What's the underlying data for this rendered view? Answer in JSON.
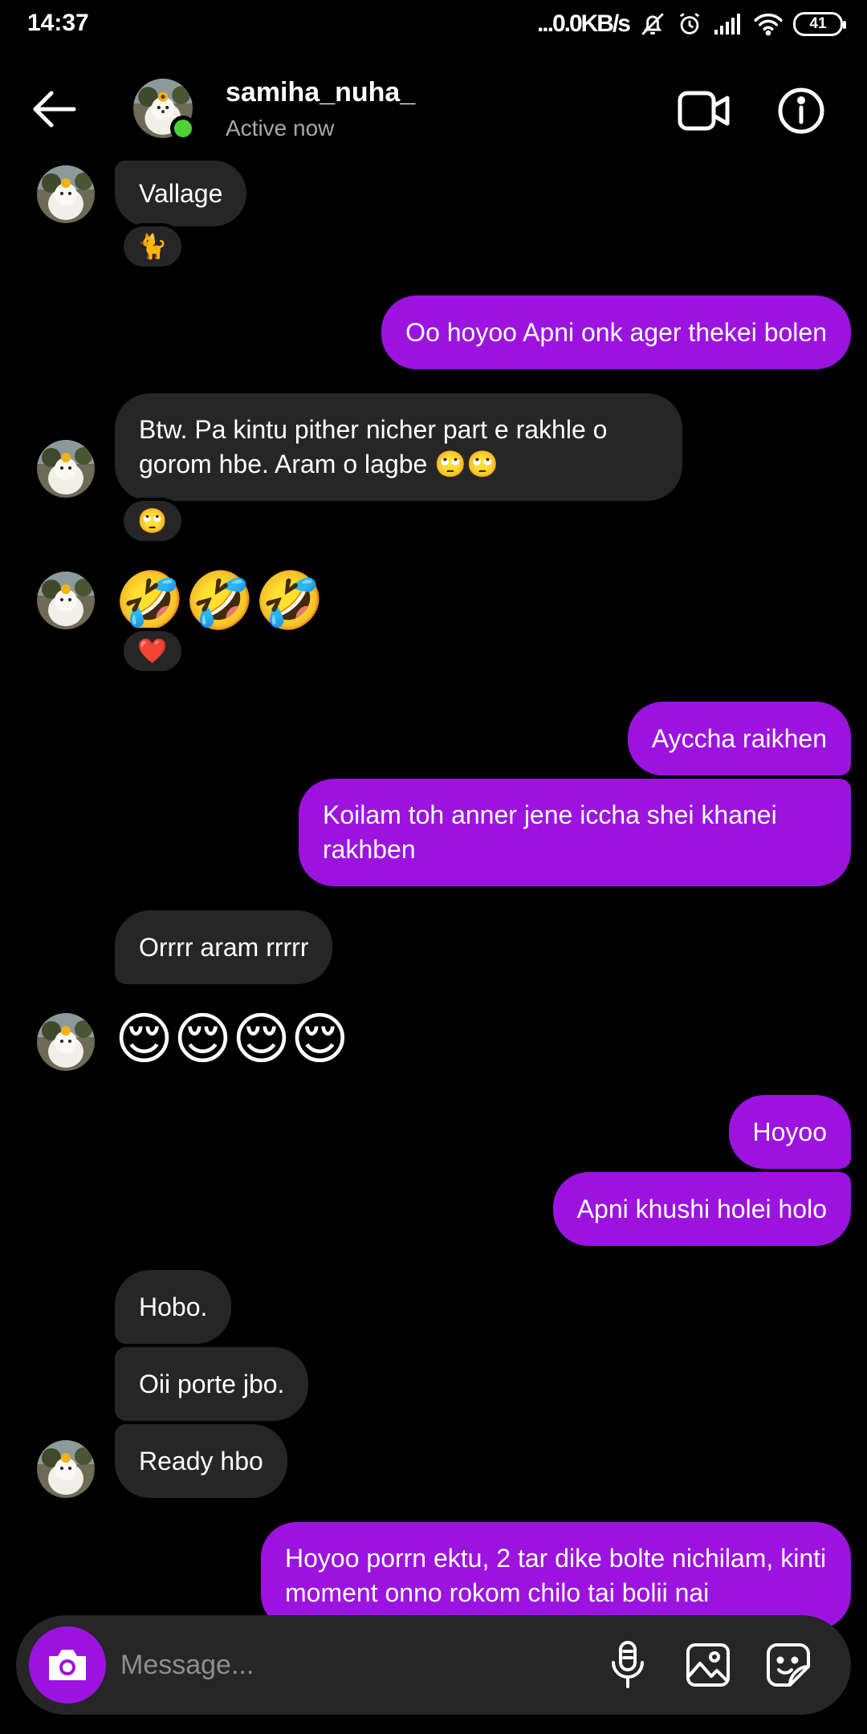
{
  "status_bar": {
    "time": "14:37",
    "network_speed": "...0.0KB/s",
    "battery": "41"
  },
  "header": {
    "username": "samiha_nuha_",
    "status": "Active now"
  },
  "messages": {
    "m1": "Vallage",
    "m1_reaction": "🐈",
    "m2": "Oo hoyoo Apni onk ager thekei bolen",
    "m3": "Btw. Pa kintu pither nicher part e rakhle o gorom hbe. Aram o lagbe 🙄🙄",
    "m3_reaction": "🙄",
    "m4": "🤣🤣🤣",
    "m4_reaction": "❤️",
    "m5": "Ayccha raikhen",
    "m6": "Koilam toh anner jene iccha shei khanei rakhben",
    "m7": "Orrrr aram rrrrr",
    "m8": "😌😌😌😌",
    "m9": "Hoyoo",
    "m10": "Apni khushi holei holo",
    "m11": "Hobo.",
    "m12": "Oii porte jbo.",
    "m13": "Ready hbo",
    "m14": "Hoyoo porrn ektu, 2 tar dike bolte nichilam, kinti moment onno rokom chilo tai bolii nai"
  },
  "composer": {
    "placeholder": "Message..."
  },
  "colors": {
    "outgoing_bubble": "#9c13e0",
    "incoming_bubble": "#262626",
    "online": "#4cd137"
  },
  "icons": [
    "back-arrow-icon",
    "video-call-icon",
    "info-icon",
    "camera-icon",
    "microphone-icon",
    "gallery-icon",
    "sticker-icon"
  ]
}
